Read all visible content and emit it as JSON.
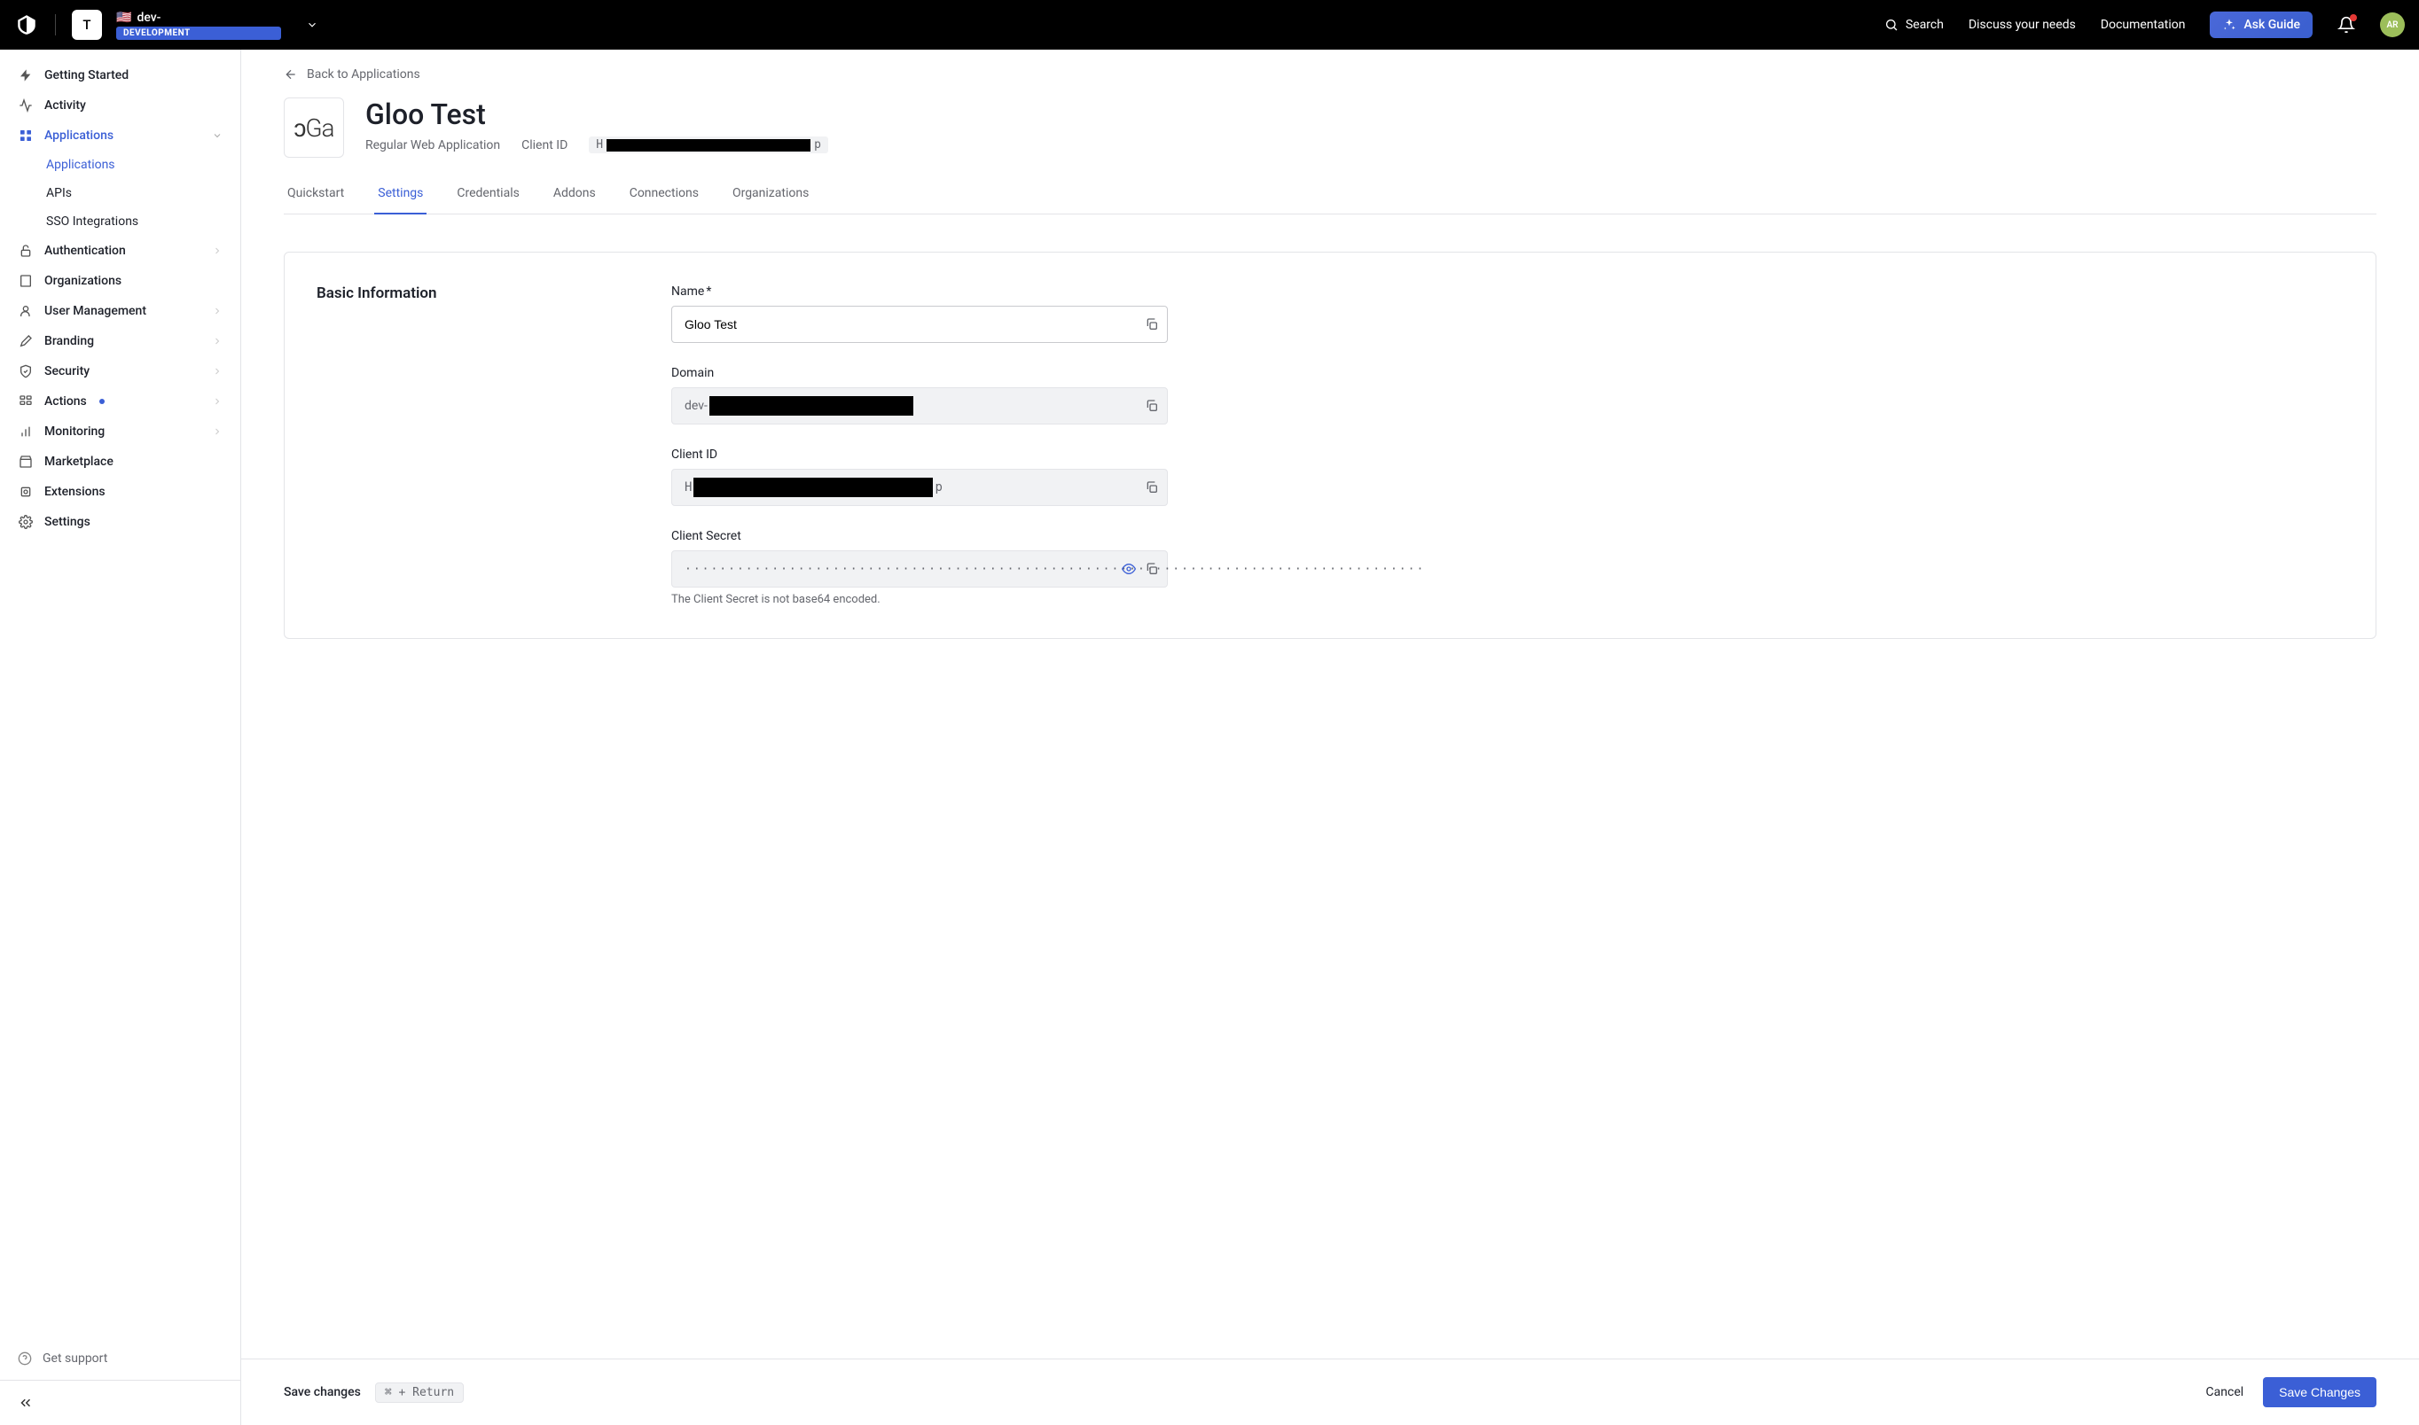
{
  "header": {
    "tenant_letter": "T",
    "tenant_prefix": "dev-",
    "env_badge": "DEVELOPMENT",
    "search_label": "Search",
    "discuss_label": "Discuss your needs",
    "documentation_label": "Documentation",
    "ask_guide_label": "Ask Guide",
    "avatar_initials": "AR"
  },
  "sidebar": {
    "items": [
      {
        "label": "Getting Started",
        "icon": "bolt"
      },
      {
        "label": "Activity",
        "icon": "activity"
      },
      {
        "label": "Applications",
        "icon": "apps",
        "active": true,
        "expandable": true
      },
      {
        "label": "Authentication",
        "icon": "lock",
        "expandable": true
      },
      {
        "label": "Organizations",
        "icon": "org"
      },
      {
        "label": "User Management",
        "icon": "user",
        "expandable": true
      },
      {
        "label": "Branding",
        "icon": "brush",
        "expandable": true
      },
      {
        "label": "Security",
        "icon": "shield",
        "expandable": true
      },
      {
        "label": "Actions",
        "icon": "actions",
        "expandable": true,
        "dot": true
      },
      {
        "label": "Monitoring",
        "icon": "chart",
        "expandable": true
      },
      {
        "label": "Marketplace",
        "icon": "market"
      },
      {
        "label": "Extensions",
        "icon": "puzzle"
      },
      {
        "label": "Settings",
        "icon": "gear"
      }
    ],
    "subitems": [
      {
        "label": "Applications",
        "active": true
      },
      {
        "label": "APIs"
      },
      {
        "label": "SSO Integrations"
      }
    ],
    "get_support": "Get support"
  },
  "page": {
    "back_label": "Back to Applications",
    "app_name": "Gloo Test",
    "app_type": "Regular Web Application",
    "client_id_label": "Client ID",
    "client_id_prefix": "H",
    "client_id_suffix": "p",
    "tabs": [
      {
        "label": "Quickstart"
      },
      {
        "label": "Settings",
        "active": true
      },
      {
        "label": "Credentials"
      },
      {
        "label": "Addons"
      },
      {
        "label": "Connections"
      },
      {
        "label": "Organizations"
      }
    ]
  },
  "form": {
    "section_title": "Basic Information",
    "name_label": "Name",
    "name_value": "Gloo Test",
    "domain_label": "Domain",
    "domain_prefix": "dev-",
    "clientid_label": "Client ID",
    "clientid_prefix": "H",
    "clientid_suffix": "p",
    "secret_label": "Client Secret",
    "secret_mask": "·····················································································",
    "secret_help": "The Client Secret is not base64 encoded."
  },
  "footer": {
    "save_text": "Save changes",
    "shortcut": "⌘ + Return",
    "cancel": "Cancel",
    "save": "Save Changes"
  }
}
